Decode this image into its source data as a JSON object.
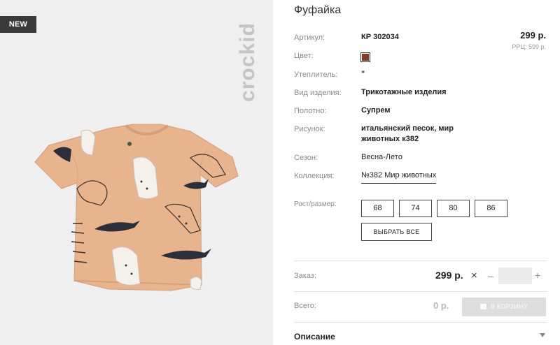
{
  "badge": "NEW",
  "brand": "crockid",
  "product": {
    "title": "Фуфайка",
    "price": "299 р.",
    "rrp": "РРЦ: 599 р."
  },
  "attributes": {
    "article": {
      "label": "Артикул:",
      "value": "КР 302034"
    },
    "color": {
      "label": "Цвет:",
      "swatch": "#8a3a22"
    },
    "insulation": {
      "label": "Утеплитель:",
      "value": "\""
    },
    "type": {
      "label": "Вид изделия:",
      "value": "Трикотажные изделия"
    },
    "fabric": {
      "label": "Полотно:",
      "value": "Супрем"
    },
    "pattern": {
      "label": "Рисунок:",
      "value_line1": "итальянский песок, мир",
      "value_line2": "животных к382"
    },
    "season": {
      "label": "Сезон:",
      "value": "Весна-Лето"
    },
    "collection": {
      "label": "Коллекция:",
      "value": "№382 Мир животных"
    }
  },
  "sizes": {
    "label": "Рост/размер:",
    "options": [
      "68",
      "74",
      "80",
      "86"
    ],
    "select_all": "ВЫБРАТЬ ВСЕ"
  },
  "order": {
    "label": "Заказ:",
    "price": "299 р.",
    "times": "×",
    "minus": "–",
    "plus": "+",
    "quantity": ""
  },
  "total": {
    "label": "Всего:",
    "value": "0 р.",
    "cart_button": "В КОРЗИНУ"
  },
  "description": {
    "label": "Описание"
  },
  "colors": {
    "shirt": "#e8b48e",
    "shirt_shadow": "#d9a37c",
    "badge_bg": "#3a3a3a",
    "disabled_button": "#dedede"
  }
}
